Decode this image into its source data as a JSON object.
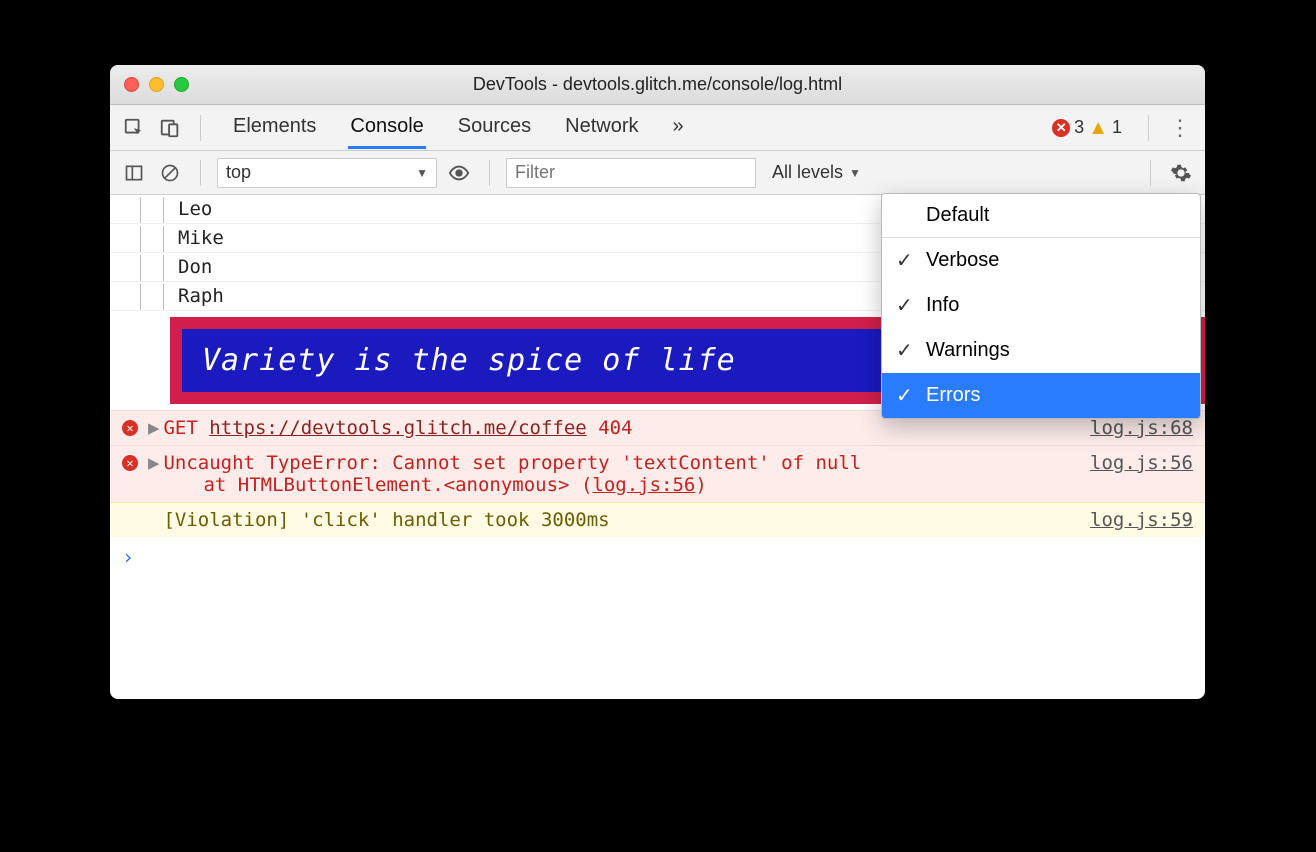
{
  "window": {
    "title": "DevTools - devtools.glitch.me/console/log.html"
  },
  "tabs": {
    "items": [
      "Elements",
      "Console",
      "Sources",
      "Network"
    ],
    "active_index": 1,
    "overflow_glyph": "»"
  },
  "badges": {
    "errors": "3",
    "warnings": "1"
  },
  "console_toolbar": {
    "context": "top",
    "filter_placeholder": "Filter",
    "levels_label": "All levels"
  },
  "levels_menu": {
    "default_label": "Default",
    "items": [
      {
        "label": "Verbose",
        "checked": true,
        "selected": false
      },
      {
        "label": "Info",
        "checked": true,
        "selected": false
      },
      {
        "label": "Warnings",
        "checked": true,
        "selected": false
      },
      {
        "label": "Errors",
        "checked": true,
        "selected": true
      }
    ]
  },
  "tree": {
    "items": [
      "Leo",
      "Mike",
      "Don",
      "Raph"
    ]
  },
  "styled_message": "Variety is the spice of life",
  "errors": [
    {
      "method": "GET",
      "url": "https://devtools.glitch.me/coffee",
      "status": "404",
      "source": "log.js:68"
    },
    {
      "headline": "Uncaught TypeError: Cannot set property 'textContent' of null",
      "stack_prefix": "at HTMLButtonElement.<anonymous> (",
      "stack_file": "log.js:56",
      "stack_suffix": ")",
      "source": "log.js:56"
    }
  ],
  "violation": {
    "text": "[Violation] 'click' handler took 3000ms",
    "source": "log.js:59"
  },
  "prompt_glyph": "›"
}
